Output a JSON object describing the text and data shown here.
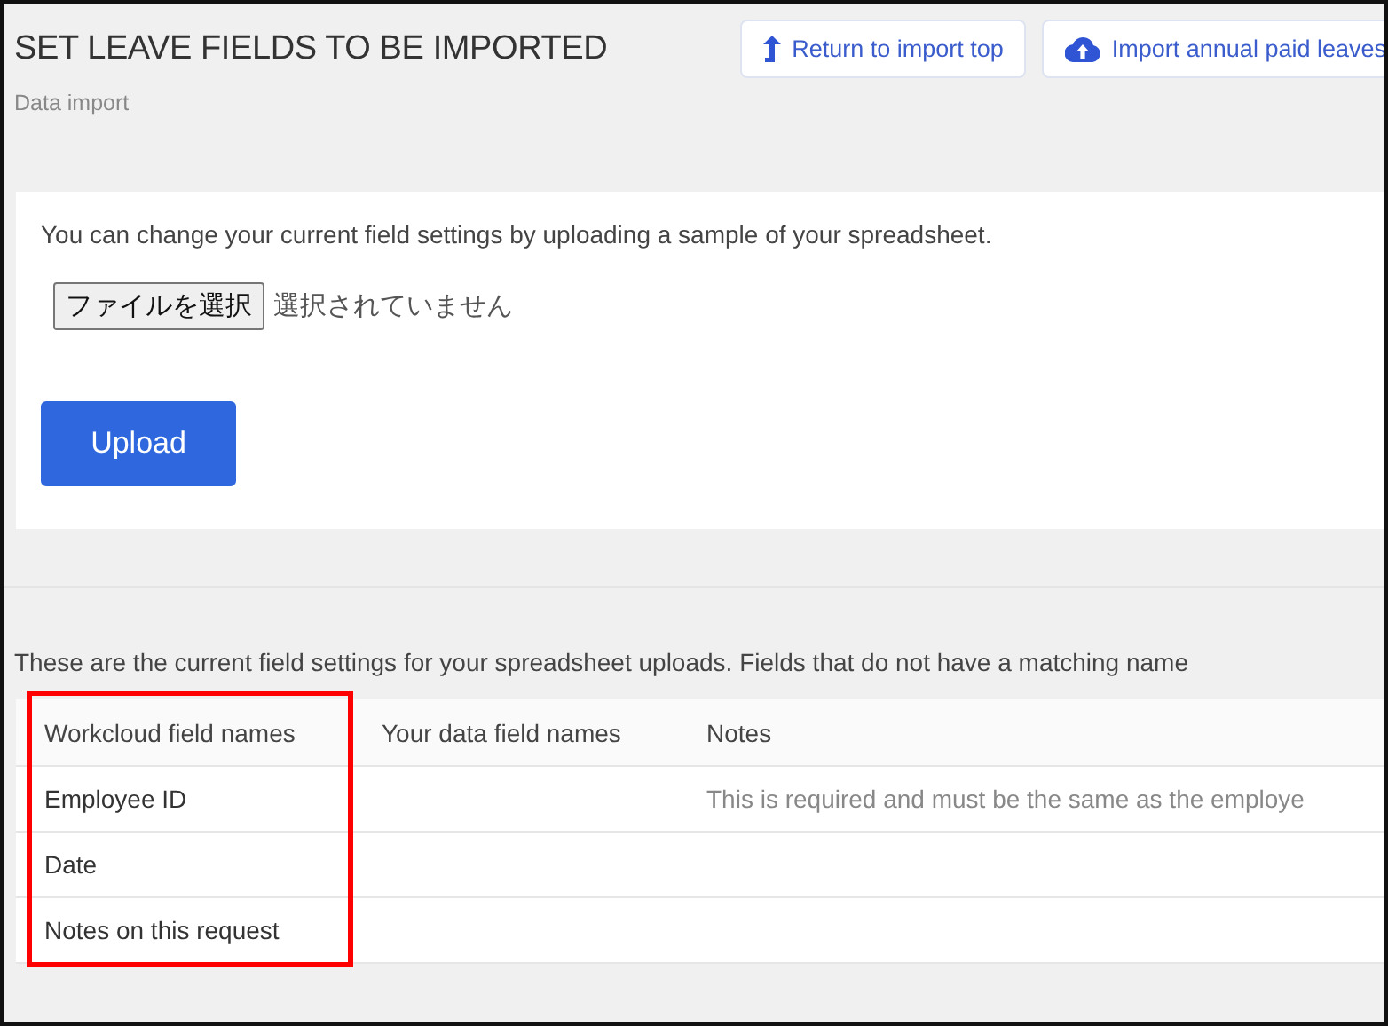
{
  "header": {
    "title": "SET LEAVE FIELDS TO BE IMPORTED",
    "breadcrumb": "Data import",
    "buttons": [
      {
        "label": "Return to import top"
      },
      {
        "label": "Import annual paid leaves"
      }
    ]
  },
  "upload_card": {
    "instruction": "You can change your current field settings by uploading a sample of your spreadsheet.",
    "file_button": "ファイルを選択",
    "file_status": "選択されていません",
    "submit": "Upload"
  },
  "settings": {
    "description": "These are the current field settings for your spreadsheet uploads. Fields that do not have a matching name",
    "table": {
      "columns": [
        {
          "label": "Workcloud field names",
          "highlighted": true
        },
        {
          "label": "Your data field names",
          "highlighted": false
        },
        {
          "label": "Notes",
          "highlighted": false
        }
      ],
      "rows": [
        {
          "cells": [
            "Employee ID",
            "",
            "This is required and must be the same as the employe"
          ]
        },
        {
          "cells": [
            "Date",
            "",
            ""
          ]
        },
        {
          "cells": [
            "Notes on this request",
            "",
            ""
          ]
        }
      ]
    }
  }
}
